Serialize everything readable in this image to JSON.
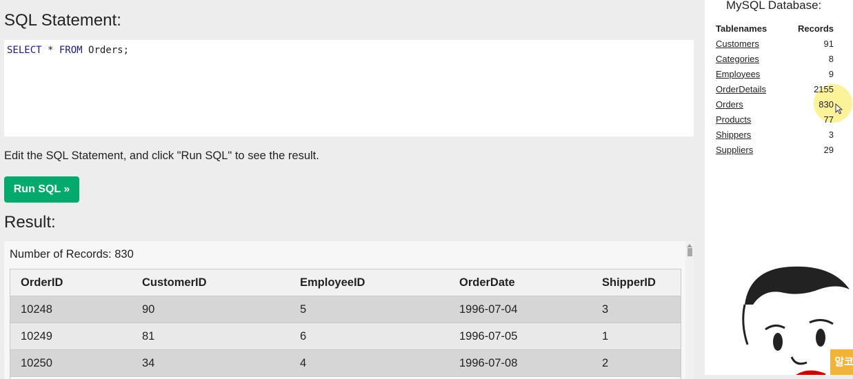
{
  "left": {
    "sql_heading": "SQL Statement:",
    "editor": {
      "kw1": "SELECT",
      "mid": " * ",
      "kw2": "FROM",
      "rest": " Orders;"
    },
    "edit_hint": "Edit the SQL Statement, and click \"Run SQL\" to see the result.",
    "run_button": "Run SQL »",
    "result_heading": "Result:",
    "num_records": "Number of Records: 830",
    "columns": [
      "OrderID",
      "CustomerID",
      "EmployeeID",
      "OrderDate",
      "ShipperID"
    ],
    "rows": [
      [
        "10248",
        "90",
        "5",
        "1996-07-04",
        "3"
      ],
      [
        "10249",
        "81",
        "6",
        "1996-07-05",
        "1"
      ],
      [
        "10250",
        "34",
        "4",
        "1996-07-08",
        "2"
      ]
    ]
  },
  "sidebar": {
    "title": "MySQL Database:",
    "col_name": "Tablenames",
    "col_records": "Records",
    "tables": [
      {
        "name": "Customers",
        "records": "91"
      },
      {
        "name": "Categories",
        "records": "8"
      },
      {
        "name": "Employees",
        "records": "9"
      },
      {
        "name": "OrderDetails",
        "records": "2155"
      },
      {
        "name": "Orders",
        "records": "830"
      },
      {
        "name": "Products",
        "records": "77"
      },
      {
        "name": "Shippers",
        "records": "3"
      },
      {
        "name": "Suppliers",
        "records": "29"
      }
    ],
    "badge": "알코"
  },
  "colors": {
    "accent": "#04aa6d",
    "highlight": "#faee78",
    "badge": "#f0b43a"
  }
}
